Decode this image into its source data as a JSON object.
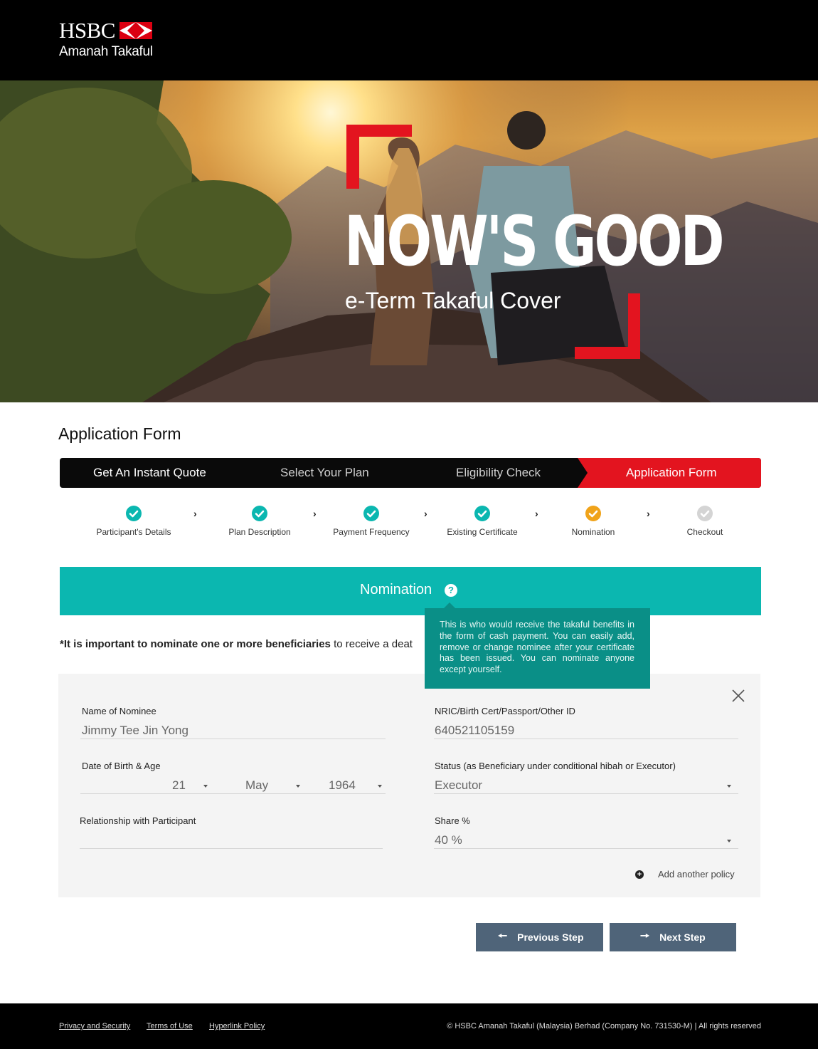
{
  "header": {
    "logo_hsbc": "HSBC",
    "logo_sub": "Amanah Takaful"
  },
  "hero": {
    "title": "NOW'S GOOD",
    "subtitle": "e-Term Takaful Cover"
  },
  "page_title": "Application Form",
  "stepbar": {
    "items": [
      {
        "label": "Get An Instant Quote"
      },
      {
        "label": "Select Your Plan"
      },
      {
        "label": "Eligibility Check"
      },
      {
        "label": "Application Form"
      }
    ],
    "active_index": 3
  },
  "substeps": [
    {
      "label": "Participant's Details",
      "status": "done"
    },
    {
      "label": "Plan Description",
      "status": "done"
    },
    {
      "label": "Payment Frequency",
      "status": "done"
    },
    {
      "label": "Existing Certificate",
      "status": "done"
    },
    {
      "label": "Nomination",
      "status": "current"
    },
    {
      "label": "Checkout",
      "status": "pending"
    }
  ],
  "banner": {
    "title": "Nomination",
    "help": "?"
  },
  "notice": {
    "bold": "*It is important to nominate one or more beneficiaries",
    "rest": " to receive a deat"
  },
  "tooltip": "This is who would receive the takaful benefits in the form of cash payment. You can easily add, remove or change nominee after your certificate has been issued. You can nominate anyone except yourself.",
  "form": {
    "name_label": "Name of Nominee",
    "name_value": "Jimmy Tee Jin Yong",
    "id_label": "NRIC/Birth Cert/Passport/Other ID",
    "id_value": "640521105159",
    "dob_label": "Date of Birth & Age",
    "dob_day": "21",
    "dob_month": "May",
    "dob_year": "1964",
    "status_label": "Status (as Beneficiary under conditional hibah or Executor)",
    "status_value": "Executor",
    "relationship_label": "Relationship with Participant",
    "relationship_value": "",
    "share_label": "Share %",
    "share_value": "40 %",
    "add_policy": "Add another policy"
  },
  "buttons": {
    "previous": "Previous Step",
    "next": "Next Step"
  },
  "footer": {
    "links": [
      "Privacy and Security",
      "Terms of Use",
      "Hyperlink Policy"
    ],
    "copyright": "© HSBC Amanah Takaful (Malaysia) Berhad (Company No. 731530-M) | All rights reserved"
  },
  "colors": {
    "brand_red": "#e3141f",
    "teal": "#0bb7b0",
    "tooltip_teal": "#0a8f87",
    "button": "#4f6479",
    "done": "#0bb7b0",
    "current": "#f0a31a",
    "pending": "#cfcfcf"
  }
}
